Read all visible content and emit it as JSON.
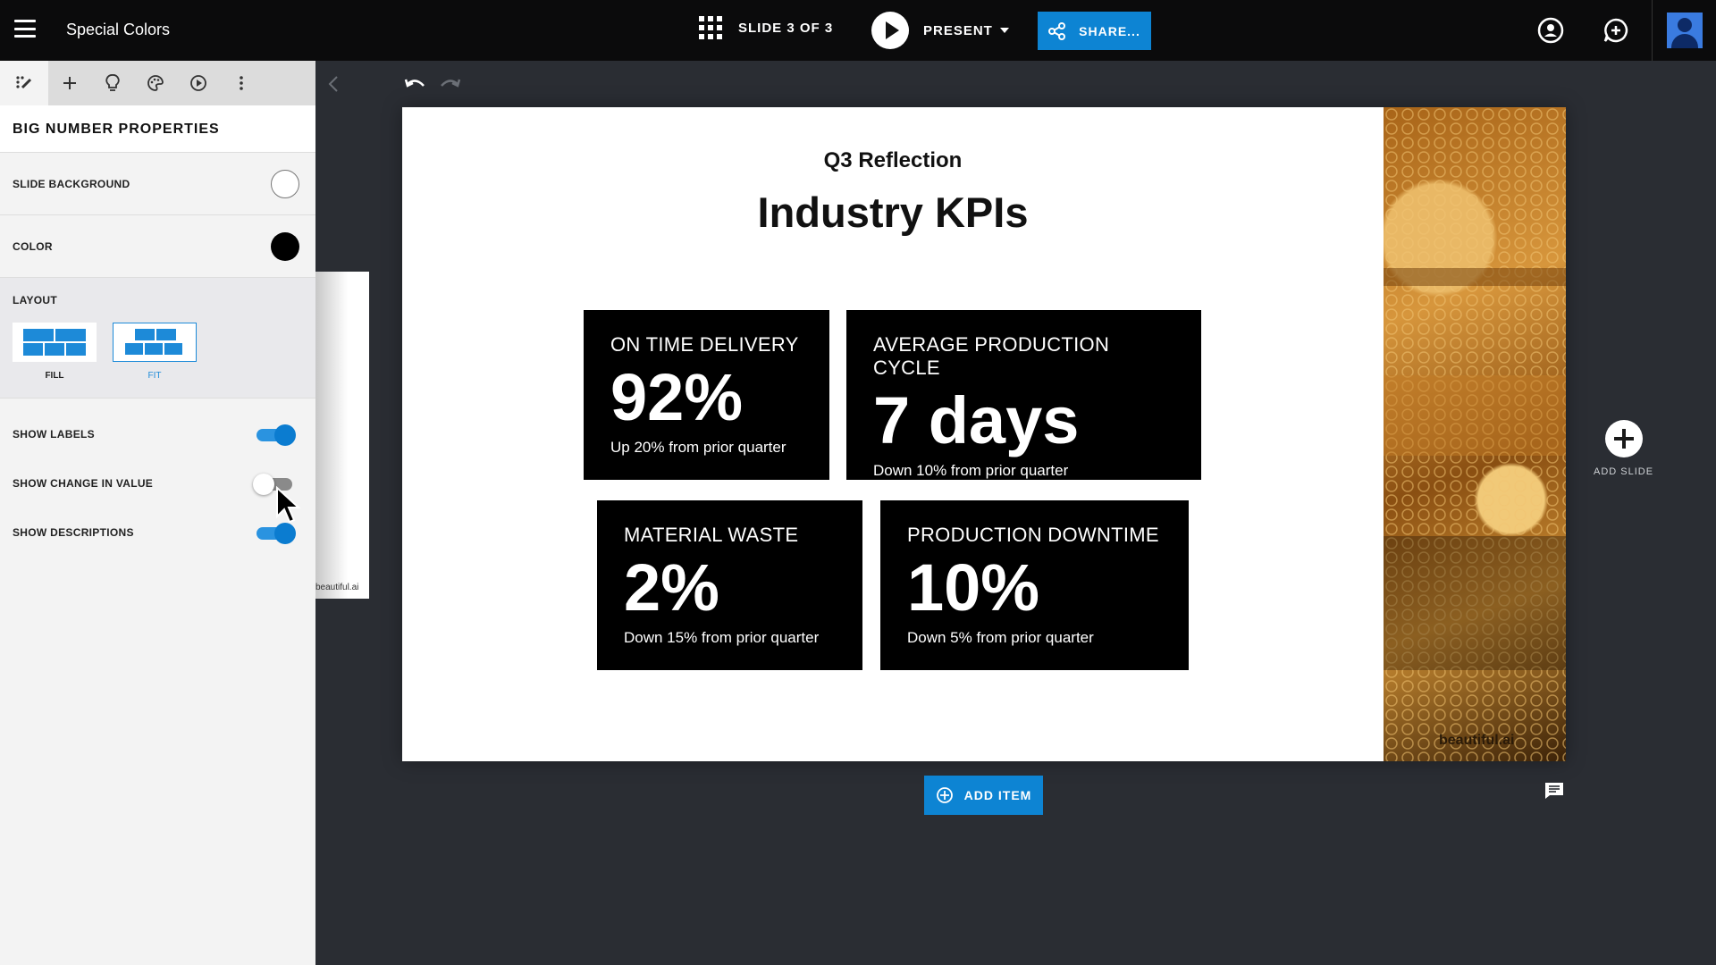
{
  "topbar": {
    "deck_title": "Special Colors",
    "slide_indicator": "SLIDE 3 OF 3",
    "present_label": "PRESENT",
    "share_label": "SHARE..."
  },
  "panel": {
    "heading": "BIG NUMBER PROPERTIES",
    "slide_background_label": "SLIDE BACKGROUND",
    "color_label": "COLOR",
    "layout_label": "LAYOUT",
    "layout_options": [
      {
        "label": "FILL",
        "selected": false
      },
      {
        "label": "FIT",
        "selected": true
      }
    ],
    "toggles": [
      {
        "label": "SHOW LABELS",
        "on": true
      },
      {
        "label": "SHOW CHANGE IN VALUE",
        "on": false
      },
      {
        "label": "SHOW DESCRIPTIONS",
        "on": true
      }
    ],
    "slide_background_color": "#ffffff",
    "color_value": "#000000"
  },
  "side_watermark": "beautiful.ai",
  "slide": {
    "subtitle": "Q3 Reflection",
    "title": "Industry KPIs",
    "kpis": [
      {
        "label": "ON TIME DELIVERY",
        "value": "92%",
        "desc": "Up 20% from prior quarter"
      },
      {
        "label": "AVERAGE PRODUCTION CYCLE",
        "value": "7 days",
        "desc": "Down 10% from prior quarter"
      },
      {
        "label": "MATERIAL WASTE",
        "value": "2%",
        "desc": "Down 15% from prior quarter"
      },
      {
        "label": "PRODUCTION DOWNTIME",
        "value": "10%",
        "desc": "Down 5% from prior quarter"
      }
    ],
    "image_watermark": "beautiful.ai"
  },
  "add_slide_label": "ADD SLIDE",
  "add_item_label": "ADD ITEM",
  "colors": {
    "accent": "#0d84d3",
    "topbar": "#0b0b0c",
    "workspace": "#2a2d33"
  }
}
